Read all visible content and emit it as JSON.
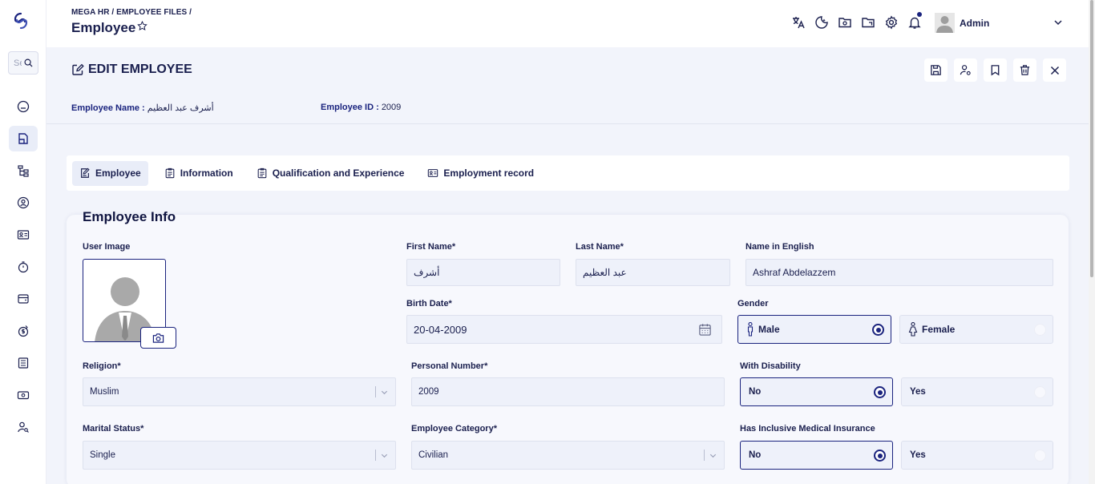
{
  "sidebar": {
    "search_placeholder": "Search",
    "items": [
      {
        "icon": "dashboard-icon",
        "active": false
      },
      {
        "icon": "employee-files-icon",
        "active": true
      },
      {
        "icon": "org-structure-icon",
        "active": false
      },
      {
        "icon": "user-circle-icon",
        "active": false
      },
      {
        "icon": "id-card-icon",
        "active": false
      },
      {
        "icon": "timer-icon",
        "active": false
      },
      {
        "icon": "wallet-icon",
        "active": false
      },
      {
        "icon": "payroll-icon",
        "active": false
      },
      {
        "icon": "document-list-icon",
        "active": false
      },
      {
        "icon": "money-icon",
        "active": false
      },
      {
        "icon": "user-search-icon",
        "active": false
      }
    ]
  },
  "header": {
    "breadcrumb": "MEGA HR / EMPLOYEE FILES /",
    "title": "Employee",
    "user_name": "Admin",
    "icons": [
      "translate-icon",
      "dark-mode-icon",
      "folder-camera-icon",
      "folder-icon",
      "settings-icon",
      "bell-icon"
    ]
  },
  "edit": {
    "title": "EDIT EMPLOYEE",
    "actions": [
      "save-icon",
      "user-settings-icon",
      "bookmark-icon",
      "delete-icon",
      "close-icon"
    ],
    "employee_name_label": "Employee Name :",
    "employee_name_value": "أشرف عبد العظيم",
    "employee_id_label": "Employee ID :",
    "employee_id_value": "2009"
  },
  "tabs": [
    {
      "label": "Employee",
      "active": true
    },
    {
      "label": "Information",
      "active": false
    },
    {
      "label": "Qualification and Experience",
      "active": false
    },
    {
      "label": "Employment record",
      "active": false
    }
  ],
  "form": {
    "section_title": "Employee Info",
    "user_image_label": "User Image",
    "first_name": {
      "label": "First Name*",
      "value": "أشرف"
    },
    "last_name": {
      "label": "Last Name*",
      "value": "عبد العظيم"
    },
    "name_english": {
      "label": "Name in English",
      "value": "Ashraf Abdelazzem"
    },
    "birth_date": {
      "label": "Birth Date*",
      "value": "20-04-2009"
    },
    "gender": {
      "label": "Gender",
      "options": [
        "Male",
        "Female"
      ],
      "selected": "Male"
    },
    "religion": {
      "label": "Religion*",
      "value": "Muslim"
    },
    "personal_number": {
      "label": "Personal Number*",
      "value": "2009"
    },
    "with_disability": {
      "label": "With Disability",
      "options": [
        "No",
        "Yes"
      ],
      "selected": "No"
    },
    "marital_status": {
      "label": "Marital Status*",
      "value": "Single"
    },
    "employee_category": {
      "label": "Employee Category*",
      "value": "Civilian"
    },
    "medical_insurance": {
      "label": "Has Inclusive Medical Insurance",
      "options": [
        "No",
        "Yes"
      ],
      "selected": "No"
    }
  },
  "colors": {
    "primary": "#1a237e",
    "text": "#1a1f4e",
    "main_bg": "#f2f4fb",
    "field_bg": "#eef1fa"
  }
}
